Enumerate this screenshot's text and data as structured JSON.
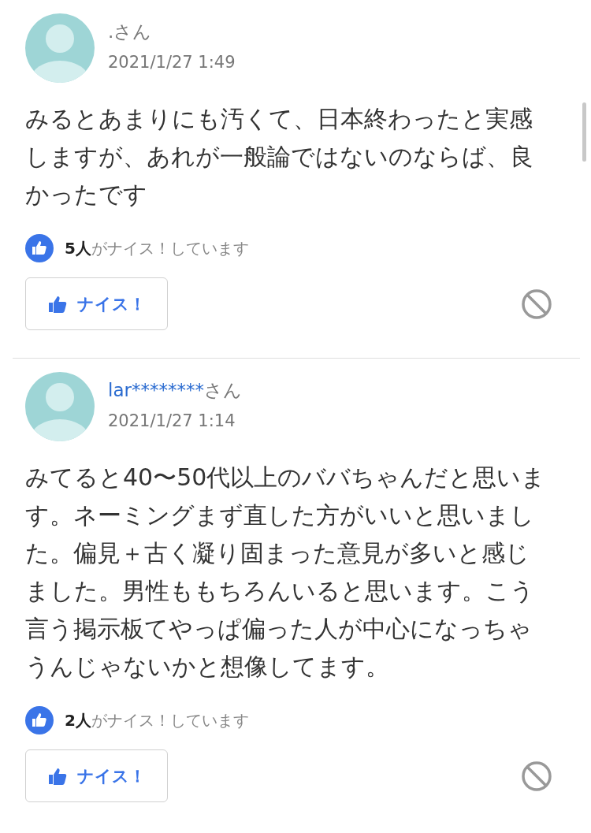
{
  "comments": [
    {
      "user": ".",
      "user_linked": false,
      "suffix": "さん",
      "date": "2021/1/27 1:49",
      "body": "みるとあまりにも汚くて、日本終わったと実感しますが、あれが一般論ではないのならば、良かったです",
      "likes": "**5人**がナイス！しています",
      "nice_button": "ナイス！"
    },
    {
      "user": "lar********",
      "user_linked": true,
      "suffix": "さん",
      "date": "2021/1/27 1:14",
      "body": "みてると40〜50代以上のババちゃんだと思います。ネーミングまず直した方がいいと思いました。偏見＋古く凝り固まった意見が多いと感じました。男性ももちろんいると思います。こう言う掲示板てやっぱ偏った人が中心になっちゃうんじゃないかと想像してます。",
      "likes": "**2人**がナイス！しています",
      "nice_button": "ナイス！"
    }
  ]
}
